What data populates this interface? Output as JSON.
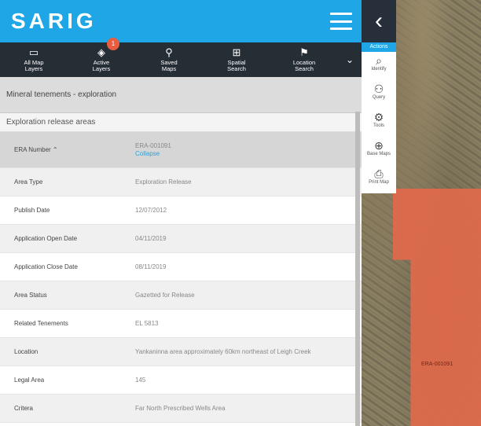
{
  "app": {
    "logo": "SARIG",
    "back_glyph": "‹"
  },
  "toolbar": {
    "items": [
      {
        "icon": "map-icon",
        "label_1": "All Map",
        "label_2": "Layers"
      },
      {
        "icon": "layers-icon",
        "label_1": "Active",
        "label_2": "Layers",
        "badge": "1"
      },
      {
        "icon": "saved-icon",
        "label_1": "Saved",
        "label_2": "Maps"
      },
      {
        "icon": "spatial-icon",
        "label_1": "Spatial",
        "label_2": "Search"
      },
      {
        "icon": "location-icon",
        "label_1": "Location",
        "label_2": "Search"
      }
    ]
  },
  "actions": {
    "title": "Actions",
    "items": [
      {
        "label": "Identify",
        "icon": "search-icon"
      },
      {
        "label": "Query",
        "icon": "query-icon"
      },
      {
        "label": "Tools",
        "icon": "tools-icon"
      },
      {
        "label": "Base Maps",
        "icon": "globe-icon"
      },
      {
        "label": "Print Map",
        "icon": "print-icon"
      }
    ]
  },
  "panel": {
    "section_title": "Mineral tenements - exploration",
    "subsection_title": "Exploration release areas",
    "header_row": {
      "label": "ERA Number",
      "value": "ERA-001091",
      "link": "Collapse"
    },
    "rows": [
      {
        "label": "Area Type",
        "value": "Exploration Release",
        "link": true
      },
      {
        "label": "Publish Date",
        "value": "12/07/2012"
      },
      {
        "label": "Application Open Date",
        "value": "04/11/2019"
      },
      {
        "label": "Application Close Date",
        "value": "08/11/2019"
      },
      {
        "label": "Area Status",
        "value": "Gazetted for Release"
      },
      {
        "label": "Related Tenements",
        "value": "EL 5813"
      },
      {
        "label": "Location",
        "value": "Yankaninna area approximately 60km northeast of Leigh Creek"
      },
      {
        "label": "Legal Area",
        "value": "145"
      },
      {
        "label": "Critera",
        "value": "Far North Prescribed Wells Area"
      }
    ]
  },
  "map": {
    "tenement_label": "ERA-001091"
  },
  "colors": {
    "accent": "#1ea6e6",
    "toolbar": "#252d35",
    "tenement": "#e1694b",
    "badge": "#e85d3f"
  }
}
